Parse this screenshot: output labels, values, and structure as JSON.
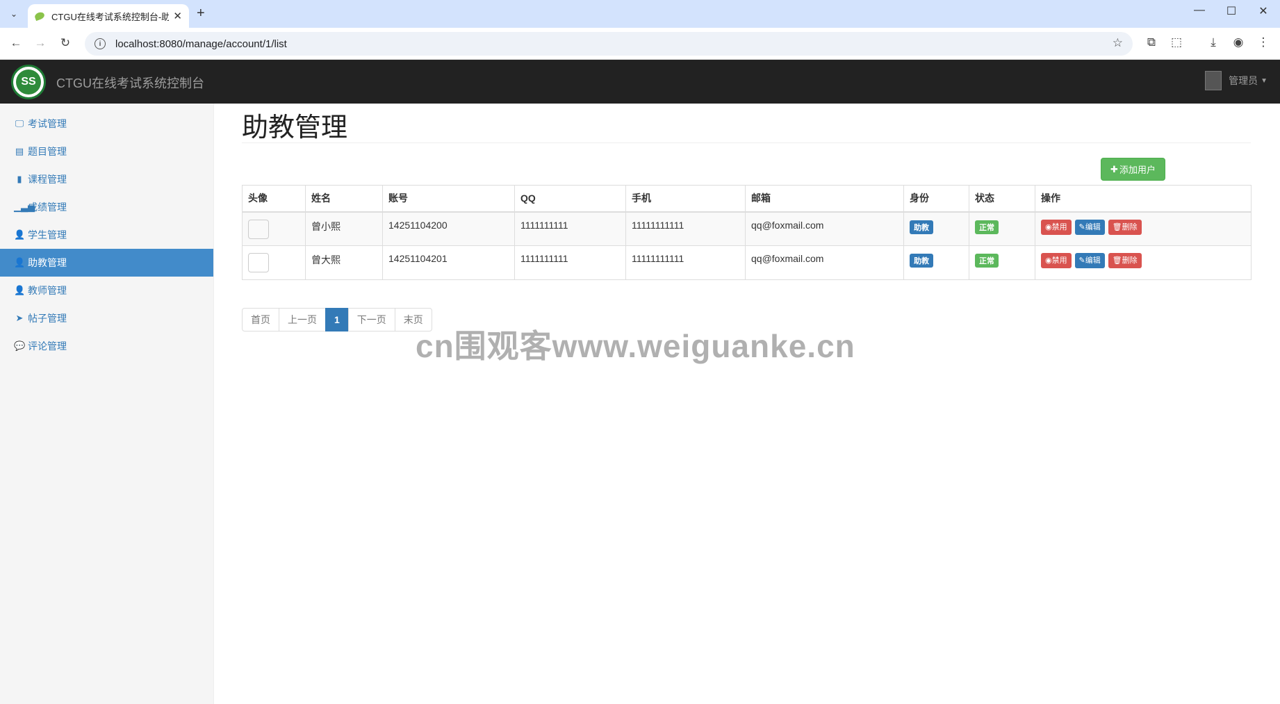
{
  "browser": {
    "tab_title": "CTGU在线考试系统控制台-助教",
    "url": "localhost:8080/manage/account/1/list"
  },
  "header": {
    "logo_text": "SS",
    "brand": "CTGU在线考试系统控制台",
    "user_label": "管理员"
  },
  "sidebar": {
    "items": [
      {
        "label": "考试管理",
        "icon": "monitor-icon"
      },
      {
        "label": "题目管理",
        "icon": "list-icon"
      },
      {
        "label": "课程管理",
        "icon": "book-icon"
      },
      {
        "label": "成绩管理",
        "icon": "signal-icon"
      },
      {
        "label": "学生管理",
        "icon": "user-icon"
      },
      {
        "label": "助教管理",
        "icon": "user-icon",
        "active": true
      },
      {
        "label": "教师管理",
        "icon": "user-icon"
      },
      {
        "label": "帖子管理",
        "icon": "send-icon"
      },
      {
        "label": "评论管理",
        "icon": "comment-icon"
      }
    ]
  },
  "main": {
    "title": "助教管理",
    "add_button": "添加用户",
    "columns": [
      "头像",
      "姓名",
      "账号",
      "QQ",
      "手机",
      "邮箱",
      "身份",
      "状态",
      "操作"
    ],
    "rows": [
      {
        "name": "曾小熙",
        "account": "14251104200",
        "qq": "1111111111",
        "phone": "11111111111",
        "email": "qq@foxmail.com",
        "role": "助教",
        "status": "正常"
      },
      {
        "name": "曾大熙",
        "account": "14251104201",
        "qq": "1111111111",
        "phone": "11111111111",
        "email": "qq@foxmail.com",
        "role": "助教",
        "status": "正常"
      }
    ],
    "actions": {
      "disable": "禁用",
      "edit": "编辑",
      "delete": "删除"
    }
  },
  "pagination": {
    "first": "首页",
    "prev": "上一页",
    "current": "1",
    "next": "下一页",
    "last": "末页"
  },
  "watermark": "cn围观客www.weiguanke.cn"
}
